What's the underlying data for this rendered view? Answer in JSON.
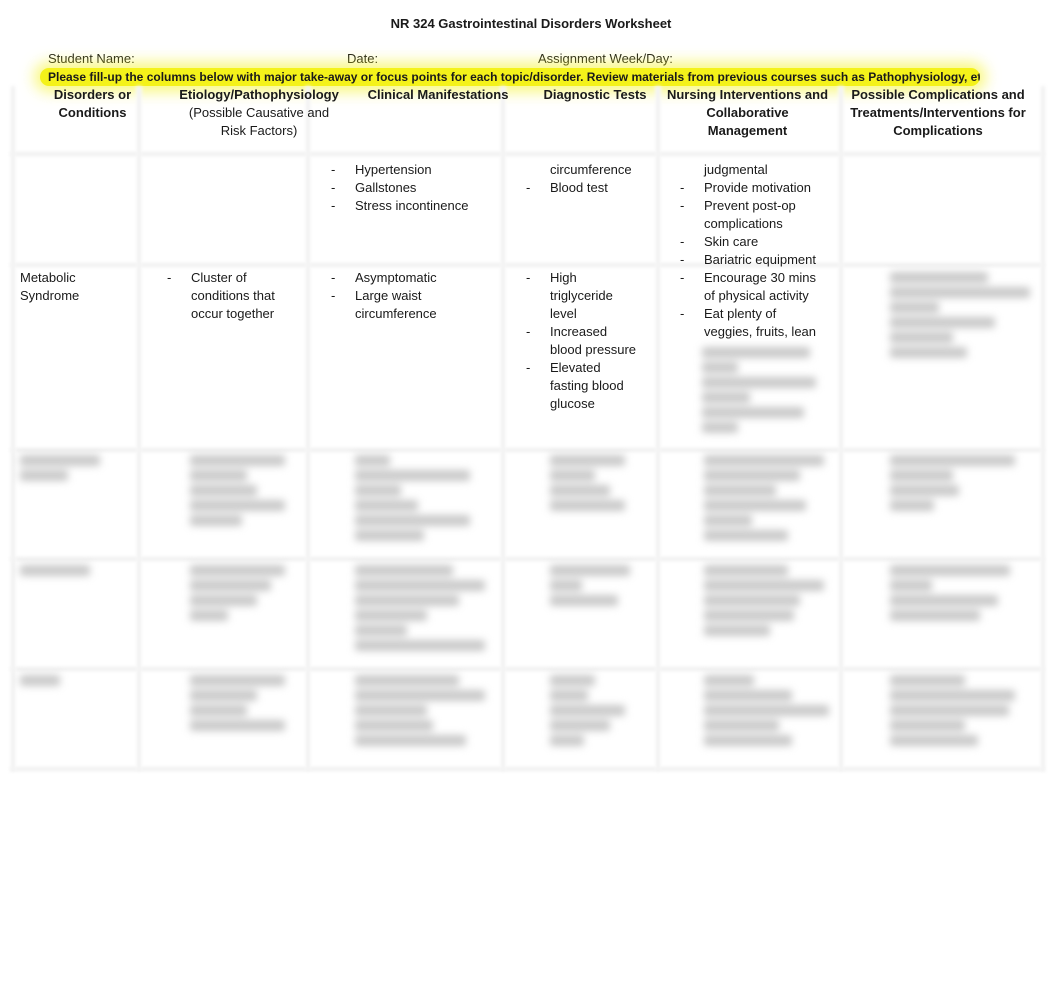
{
  "document": {
    "title": "NR 324 Gastrointestinal Disorders Worksheet",
    "fields": {
      "student_name_label": "Student Name:",
      "date_label": "Date:",
      "assignment_label": "Assignment Week/Day:"
    },
    "instructions": "Please fill-up the columns below with major take-away or focus points for each topic/disorder. Review materials from previous courses such as Pathophysiology, etc.",
    "highlight_color": "#f4f21a"
  },
  "table": {
    "headers": [
      {
        "title": "Disorders or Conditions",
        "line1": "Disorders or",
        "line2": "Conditions",
        "line3": ""
      },
      {
        "title": "Etiology/Pathophysiology",
        "line1": "Etiology/Pathophysiology",
        "line2": "(Possible Causative and",
        "line3": "Risk Factors)"
      },
      {
        "title": "Clinical Manifestations",
        "line1": "Clinical Manifestations",
        "line2": "",
        "line3": ""
      },
      {
        "title": "Diagnostic Tests",
        "line1": "Diagnostic Tests",
        "line2": "",
        "line3": ""
      },
      {
        "title": "Nursing Interventions and Collaborative Management",
        "line1": "Nursing Interventions and",
        "line2": "Collaborative",
        "line3": "Management"
      },
      {
        "title": "Possible Complications and Treatments/Interventions for Complications",
        "line1": "Possible Complications and",
        "line2": "Treatments/Interventions for",
        "line3": "Complications"
      }
    ],
    "row_obesity_continued": {
      "clinical_manifestations": [
        "Hypertension",
        "Gallstones",
        "Stress incontinence"
      ],
      "diagnostic_tests_continued": "circumference",
      "diagnostic_tests": [
        "Blood test"
      ],
      "nursing_continued": "judgmental",
      "nursing": [
        "Provide motivation",
        "Prevent post-op",
        "complications",
        "Skin care",
        "Bariatric equipment"
      ]
    },
    "row_metabolic_syndrome": {
      "disorder_line1": "Metabolic",
      "disorder_line2": "Syndrome",
      "etiology": [
        "Cluster of",
        "conditions that",
        "occur together"
      ],
      "clinical_manifestations": [
        "Asymptomatic",
        "Large waist",
        "circumference"
      ],
      "diagnostic_tests": [
        "High",
        "triglyceride",
        "level",
        "Increased",
        "blood pressure",
        "Elevated",
        "fasting blood",
        "glucose"
      ],
      "nursing": [
        "Encourage 30 mins",
        "of physical activity",
        "Eat plenty of",
        "veggies, fruits, lean"
      ]
    },
    "blurred_rows_note": "Remaining rows are blurred / unreadable"
  }
}
